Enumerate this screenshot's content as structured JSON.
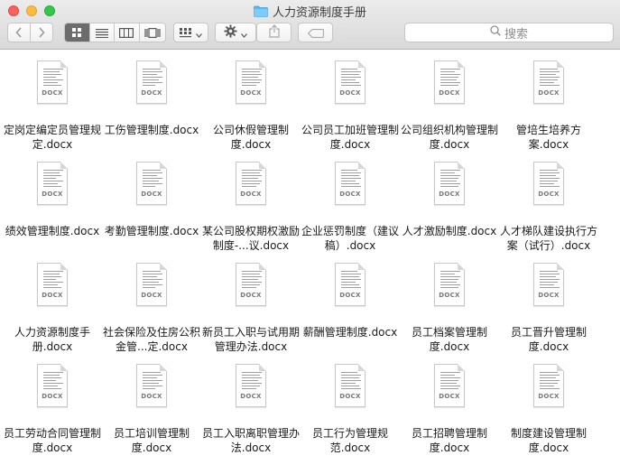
{
  "window": {
    "title": "人力资源制度手册"
  },
  "toolbar": {
    "back_icon": "chevron-left-icon",
    "forward_icon": "chevron-right-icon",
    "view_icons": [
      "icon-view-icon",
      "list-view-icon",
      "column-view-icon",
      "cover-flow-view-icon"
    ],
    "group_icon": "group-by-icon",
    "action_icon": "gear-icon",
    "share_icon": "share-icon",
    "tag_icon": "tag-icon"
  },
  "search": {
    "placeholder": "搜索"
  },
  "files": [
    {
      "name": "定岗定编定员管理规定.docx",
      "label": "DOCX"
    },
    {
      "name": "工伤管理制度.docx",
      "label": "DOCX"
    },
    {
      "name": "公司休假管理制度.docx",
      "label": "DOCX"
    },
    {
      "name": "公司员工加班管理制度.docx",
      "label": "DOCX"
    },
    {
      "name": "公司组织机构管理制度.docx",
      "label": "DOCX"
    },
    {
      "name": "管培生培养方案.docx",
      "label": "DOCX"
    },
    {
      "name": "绩效管理制度.docx",
      "label": "DOCX"
    },
    {
      "name": "考勤管理制度.docx",
      "label": "DOCX"
    },
    {
      "name": "某公司股权期权激励制度-...议.docx",
      "label": "DOCX"
    },
    {
      "name": "企业惩罚制度（建议稿）.docx",
      "label": "DOCX"
    },
    {
      "name": "人才激励制度.docx",
      "label": "DOCX"
    },
    {
      "name": "人才梯队建设执行方案（试行）.docx",
      "label": "DOCX"
    },
    {
      "name": "人力资源制度手册.docx",
      "label": "DOCX"
    },
    {
      "name": "社会保险及住房公积金管...定.docx",
      "label": "DOCX"
    },
    {
      "name": "新员工入职与试用期管理办法.docx",
      "label": "DOCX"
    },
    {
      "name": "薪酬管理制度.docx",
      "label": "DOCX"
    },
    {
      "name": "员工档案管理制度.docx",
      "label": "DOCX"
    },
    {
      "name": "员工晋升管理制度.docx",
      "label": "DOCX"
    },
    {
      "name": "员工劳动合同管理制度.docx",
      "label": "DOCX"
    },
    {
      "name": "员工培训管理制度.docx",
      "label": "DOCX"
    },
    {
      "name": "员工入职离职管理办法.docx",
      "label": "DOCX"
    },
    {
      "name": "员工行为管理规范.docx",
      "label": "DOCX"
    },
    {
      "name": "员工招聘管理制度.docx",
      "label": "DOCX"
    },
    {
      "name": "制度建设管理制度.docx",
      "label": "DOCX"
    }
  ]
}
